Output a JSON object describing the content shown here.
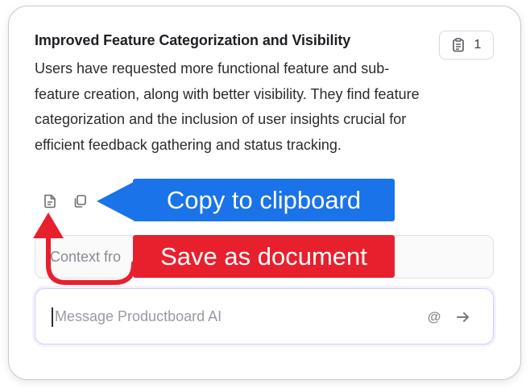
{
  "card": {
    "title": "Improved Feature Categorization and Visibility",
    "body": "Users have requested more functional feature and sub-feature creation, along with better visibility. They find feature categorization and the inclusion of user insights crucial for efficient feedback gathering and status tracking.",
    "badge": {
      "icon": "document-list-icon",
      "count": "1"
    },
    "actions": {
      "save_icon": "document-icon",
      "copy_icon": "copy-icon"
    }
  },
  "context_field": {
    "value": "Context fro"
  },
  "message_box": {
    "placeholder": "Message Productboard AI",
    "mention_symbol": "@",
    "send_icon": "arrow-right-icon"
  },
  "annotations": {
    "copy": {
      "label": "Copy to clipboard",
      "color": "#1a73e8"
    },
    "save": {
      "label": "Save as document",
      "color": "#e8202e"
    }
  }
}
